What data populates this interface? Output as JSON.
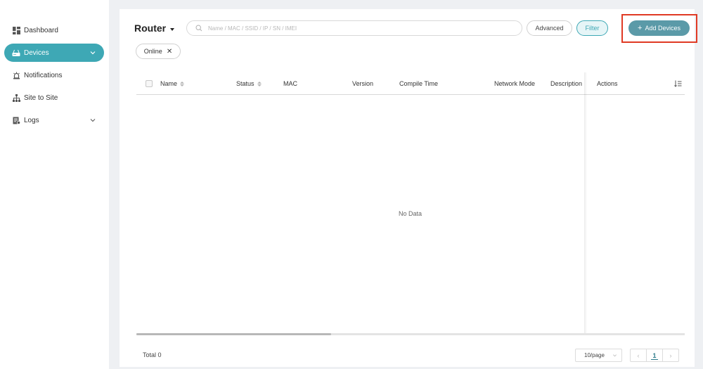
{
  "sidebar": {
    "items": [
      {
        "label": "Dashboard",
        "icon": "dashboard-icon"
      },
      {
        "label": "Devices",
        "icon": "router-icon",
        "active": true,
        "expandable": true
      },
      {
        "label": "Notifications",
        "icon": "alarm-icon"
      },
      {
        "label": "Site to Site",
        "icon": "sitemap-icon"
      },
      {
        "label": "Logs",
        "icon": "log-icon",
        "expandable": true
      }
    ]
  },
  "header": {
    "title": "Router",
    "search_placeholder": "Name / MAC / SSID / IP / SN / IMEI",
    "search_value": "",
    "advanced_label": "Advanced",
    "filter_label": "Filter",
    "add_label": "Add Devices"
  },
  "filters": {
    "active_chip": "Online"
  },
  "table": {
    "columns": [
      "Name",
      "Status",
      "MAC",
      "Version",
      "Compile Time",
      "Network Mode",
      "Description",
      "Actions"
    ],
    "rows": [],
    "empty_text": "No Data"
  },
  "footer": {
    "total_label": "Total 0",
    "page_size": "10/page",
    "current_page": "1"
  },
  "colors": {
    "accent": "#3ea8b5",
    "add_button": "#5b9aa8",
    "highlight": "#e03a24"
  }
}
